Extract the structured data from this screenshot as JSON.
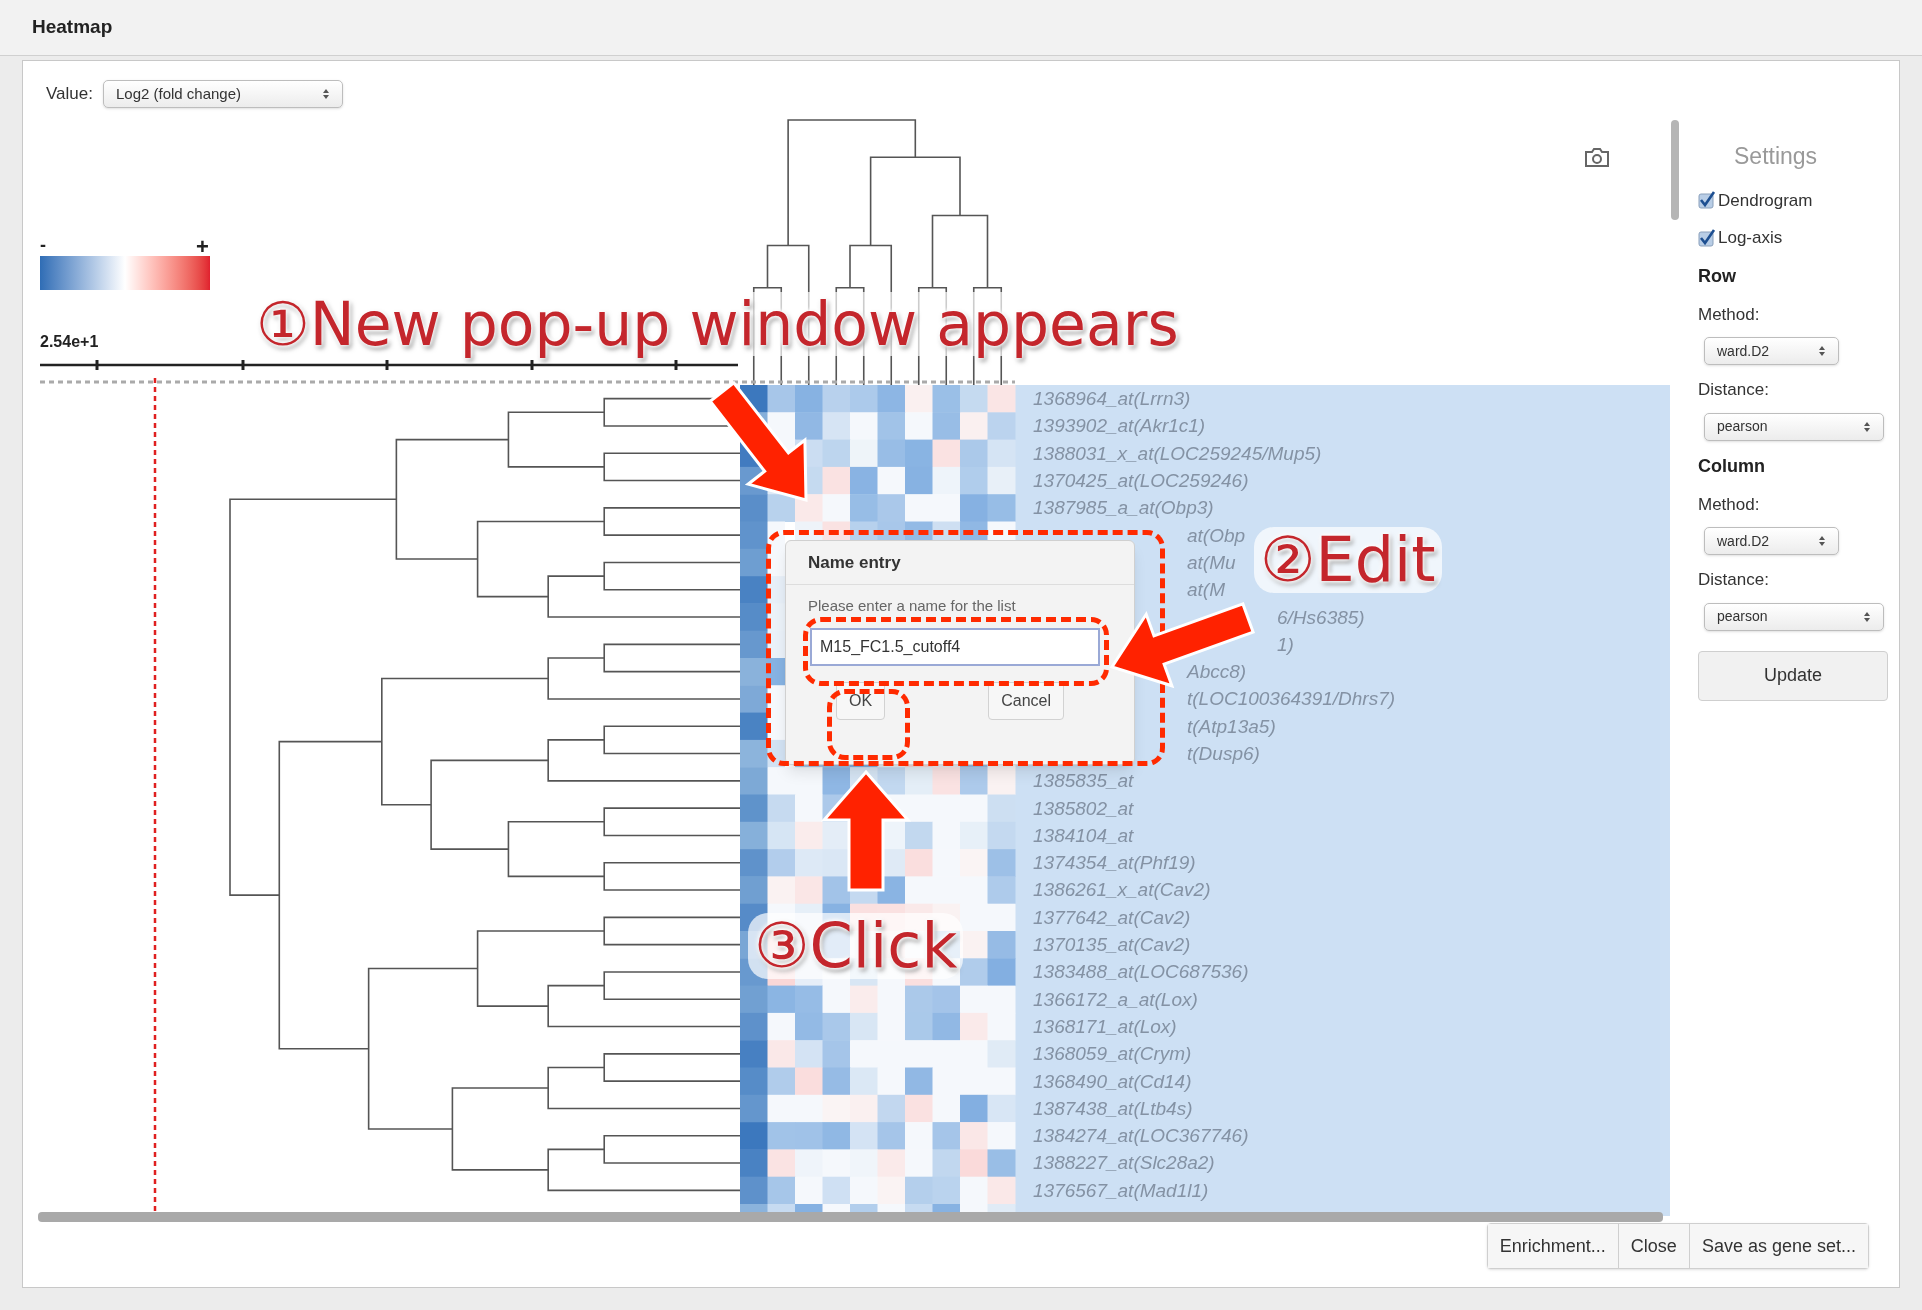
{
  "window": {
    "title": "Heatmap"
  },
  "value_select": {
    "label": "Value:",
    "value": "Log2 (fold change)"
  },
  "color_scale": {
    "min_label": "-",
    "max_label": "+"
  },
  "axis": {
    "label": "2.54e+1"
  },
  "gene_labels": [
    {
      "text": "1368964_at(Lrrn3)",
      "kind": "full"
    },
    {
      "text": "1393902_at(Akr1c1)",
      "kind": "full"
    },
    {
      "text": "1388031_x_at(LOC259245/Mup5)",
      "kind": "full"
    },
    {
      "text": "1370425_at(LOC259246)",
      "kind": "full"
    },
    {
      "text": "1387985_a_at(Obp3)",
      "kind": "full"
    },
    {
      "text": "at(Obp",
      "kind": "after-popup"
    },
    {
      "text": "at(Mu",
      "kind": "after-popup"
    },
    {
      "text": "at(M",
      "kind": "after-popup"
    },
    {
      "text": "6/Hs6385)",
      "kind": "after-arrow"
    },
    {
      "text": "1)",
      "kind": "after-arrow"
    },
    {
      "text": "Abcc8)",
      "kind": "after-popup"
    },
    {
      "text": "t(LOC100364391/Dhrs7)",
      "kind": "after-popup"
    },
    {
      "text": "t(Atp13a5)",
      "kind": "after-popup"
    },
    {
      "text": "t(Dusp6)",
      "kind": "after-popup"
    },
    {
      "text": "1385835_at",
      "kind": "full"
    },
    {
      "text": "1385802_at",
      "kind": "full"
    },
    {
      "text": "1384104_at",
      "kind": "full"
    },
    {
      "text": "1374354_at(Phf19)",
      "kind": "full"
    },
    {
      "text": "1386261_x_at(Cav2)",
      "kind": "full"
    },
    {
      "text": "1377642_at(Cav2)",
      "kind": "full"
    },
    {
      "text": "1370135_at(Cav2)",
      "kind": "full"
    },
    {
      "text": "1383488_at(LOC687536)",
      "kind": "full"
    },
    {
      "text": "1366172_a_at(Lox)",
      "kind": "full"
    },
    {
      "text": "1368171_at(Lox)",
      "kind": "full"
    },
    {
      "text": "1368059_at(Crym)",
      "kind": "full"
    },
    {
      "text": "1368490_at(Cd14)",
      "kind": "full"
    },
    {
      "text": "1387438_at(Ltb4s)",
      "kind": "full"
    },
    {
      "text": "1384274_at(LOC367746)",
      "kind": "full"
    },
    {
      "text": "1388227_at(Slc28a2)",
      "kind": "full"
    },
    {
      "text": "1376567_at(Mad1l1)",
      "kind": "full"
    }
  ],
  "settings": {
    "title": "Settings",
    "checkboxes": [
      {
        "label": "Dendrogram",
        "checked": true
      },
      {
        "label": "Log-axis",
        "checked": true
      }
    ],
    "sections": [
      {
        "heading": "Row",
        "fields": [
          {
            "label": "Method:",
            "value": "ward.D2"
          },
          {
            "label": "Distance:",
            "value": "pearson"
          }
        ]
      },
      {
        "heading": "Column",
        "fields": [
          {
            "label": "Method:",
            "value": "ward.D2"
          },
          {
            "label": "Distance:",
            "value": "pearson"
          }
        ]
      }
    ],
    "update_button": "Update"
  },
  "footer_buttons": [
    "Enrichment...",
    "Close",
    "Save as gene set..."
  ],
  "dialog": {
    "title": "Name entry",
    "prompt": "Please enter a name for the list",
    "value": "M15_FC1.5_cutoff4",
    "buttons": [
      "OK",
      "Cancel"
    ]
  },
  "annotations": [
    {
      "text": "①New pop-up window appears"
    },
    {
      "text": "②Edit"
    },
    {
      "text": "③Click"
    }
  ]
}
